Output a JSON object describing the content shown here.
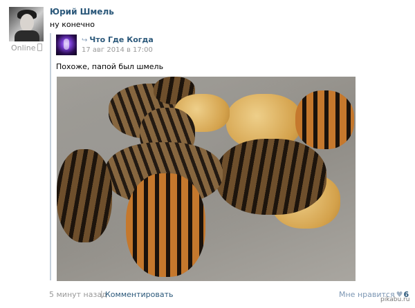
{
  "post": {
    "author": "Юрий Шмель",
    "text": "ну конечно",
    "online_status": "Online"
  },
  "repost": {
    "source": "Что Где Когда",
    "date": "17 авг 2014 в 17:00",
    "text": "Похоже, папой был шмель"
  },
  "footer": {
    "time_ago": "5 минут назад",
    "separator": "|",
    "comment_label": "Комментировать",
    "likes_label": "Мне нравится",
    "likes_count": "6"
  },
  "watermark": "pikabu.ru",
  "icons": {
    "phone": "mobile-phone-icon",
    "share": "repost-arrow-icon",
    "heart": "heart-icon"
  },
  "colors": {
    "link": "#2b587a",
    "muted": "#999999",
    "repost_bar": "#c5d0db"
  }
}
